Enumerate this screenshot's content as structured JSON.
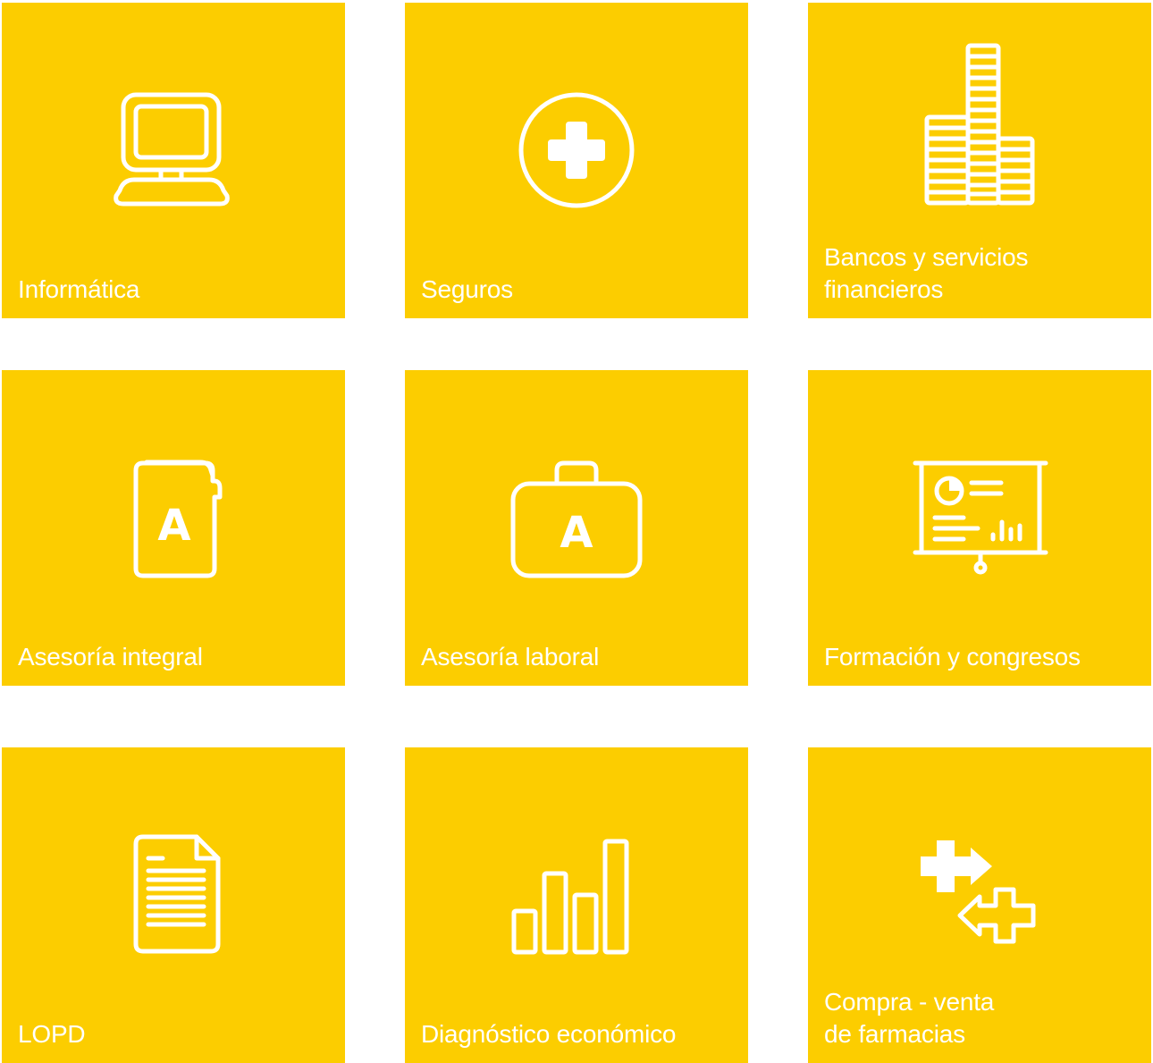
{
  "tiles": [
    {
      "id": "informatica",
      "label": "Informática",
      "icon": "computer-icon"
    },
    {
      "id": "seguros",
      "label": "Seguros",
      "icon": "medical-cross-icon"
    },
    {
      "id": "bancos",
      "label": "Bancos y servicios\nfinancieros",
      "icon": "coin-stacks-icon"
    },
    {
      "id": "asesoria-integral",
      "label": "Asesoría integral",
      "icon": "folder-a-icon"
    },
    {
      "id": "asesoria-laboral",
      "label": "Asesoría laboral",
      "icon": "briefcase-a-icon"
    },
    {
      "id": "formacion",
      "label": "Formación y congresos",
      "icon": "presentation-board-icon"
    },
    {
      "id": "lopd",
      "label": "LOPD",
      "icon": "document-icon"
    },
    {
      "id": "diagnostico",
      "label": "Diagnóstico económico",
      "icon": "bar-chart-icon"
    },
    {
      "id": "compraventa",
      "label": "Compra - venta\nde farmacias",
      "icon": "exchange-cross-icon"
    }
  ],
  "colors": {
    "tile_background": "#fccd00",
    "foreground": "#ffffff"
  }
}
